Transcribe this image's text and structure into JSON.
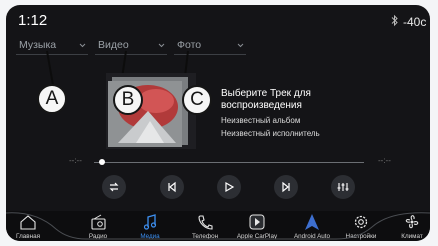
{
  "status": {
    "time": "1:12",
    "temperature": "-40c",
    "bluetooth_icon": "bluetooth-icon"
  },
  "tabs": [
    {
      "label": "Музыка",
      "icon": "chevron-down-icon"
    },
    {
      "label": "Видео",
      "icon": "chevron-down-icon"
    },
    {
      "label": "Фото",
      "icon": "chevron-down-icon"
    }
  ],
  "callouts": [
    "A",
    "B",
    "C"
  ],
  "track": {
    "prompt": "Выберите Трек для воспроизведения",
    "album": "Неизвестный альбом",
    "artist": "Неизвестный исполнитель"
  },
  "progress": {
    "elapsed": "--:--",
    "total": "--:--",
    "fraction": 0.02
  },
  "controls": [
    "repeat-icon",
    "previous-icon",
    "play-icon",
    "next-icon",
    "equalizer-icon"
  ],
  "nav": [
    {
      "label": "Главная",
      "icon": "home-icon"
    },
    {
      "label": "Радио",
      "icon": "radio-icon"
    },
    {
      "label": "Медиа",
      "icon": "music-note-icon",
      "active": true
    },
    {
      "label": "Телефон",
      "icon": "phone-icon"
    },
    {
      "label": "Apple CarPlay",
      "icon": "carplay-icon"
    },
    {
      "label": "Android Auto",
      "icon": "android-auto-icon"
    },
    {
      "label": "Настройки",
      "icon": "gear-icon"
    },
    {
      "label": "Климат",
      "icon": "fan-icon"
    }
  ],
  "colors": {
    "accent": "#3d8ff0",
    "background": "#141417",
    "panel": "#2c2e33"
  }
}
